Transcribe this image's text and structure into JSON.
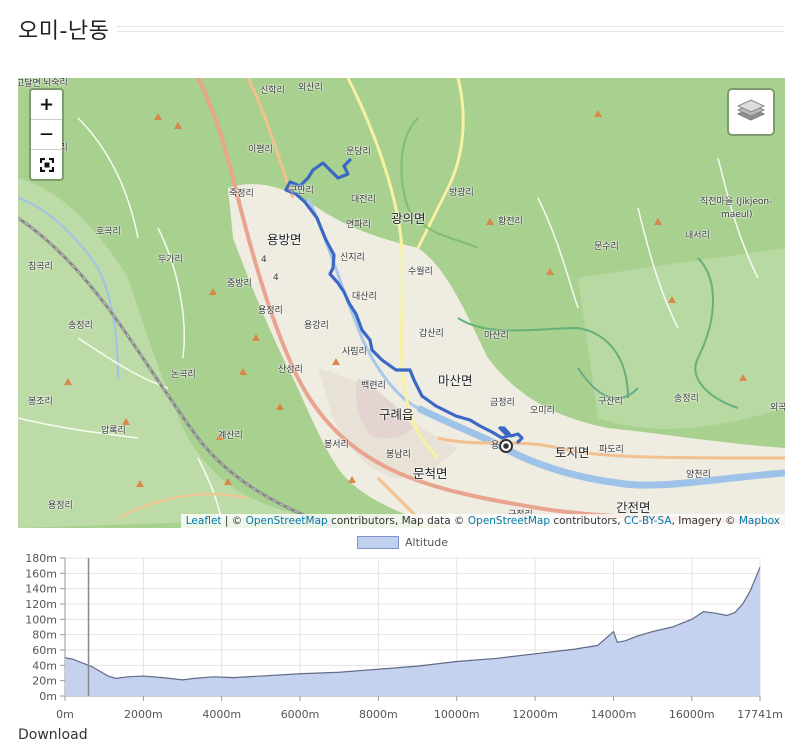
{
  "page": {
    "title": "오미-난동"
  },
  "map": {
    "zoom_in_label": "+",
    "zoom_out_label": "—",
    "fullscreen_label": "⛶",
    "attribution": {
      "leaflet": "Leaflet",
      "sep1": " | © ",
      "osm1": "OpenStreetMap",
      "mid1": " contributors, Map data © ",
      "osm2": "OpenStreetMap",
      "mid2": " contributors, ",
      "license": "CC-BY-SA",
      "mid3": ", Imagery © ",
      "mapbox": "Mapbox"
    },
    "places": [
      {
        "name": "고달면",
        "major": false
      },
      {
        "name": "뇌죽리",
        "major": false
      },
      {
        "name": "외산리",
        "major": false
      },
      {
        "name": "신학리",
        "major": false
      },
      {
        "name": "이평리",
        "major": false
      },
      {
        "name": "운당리",
        "major": false
      },
      {
        "name": "고달리",
        "major": false
      },
      {
        "name": "죽정리",
        "major": false
      },
      {
        "name": "구만리",
        "major": false
      },
      {
        "name": "대전리",
        "major": false
      },
      {
        "name": "방광리",
        "major": false
      },
      {
        "name": "용방면",
        "major": true
      },
      {
        "name": "연파리",
        "major": false
      },
      {
        "name": "광의면",
        "major": true
      },
      {
        "name": "황전리",
        "major": false
      },
      {
        "name": "직전마을 (Jikjeon-",
        "major": false
      },
      {
        "name": "maeul)",
        "major": false
      },
      {
        "name": "호곡리",
        "major": false
      },
      {
        "name": "두가리",
        "major": false
      },
      {
        "name": "신지리",
        "major": false
      },
      {
        "name": "수월리",
        "major": false
      },
      {
        "name": "내서리",
        "major": false
      },
      {
        "name": "문수리",
        "major": false
      },
      {
        "name": "침곡리",
        "major": false
      },
      {
        "name": "중방리",
        "major": false
      },
      {
        "name": "대산리",
        "major": false
      },
      {
        "name": "용정리",
        "major": false
      },
      {
        "name": "송정리",
        "major": false
      },
      {
        "name": "용강리",
        "major": false
      },
      {
        "name": "갑산리",
        "major": false
      },
      {
        "name": "마산리",
        "major": false
      },
      {
        "name": "사림리",
        "major": false
      },
      {
        "name": "논곡리",
        "major": false
      },
      {
        "name": "산성리",
        "major": false
      },
      {
        "name": "마산면",
        "major": true
      },
      {
        "name": "백련리",
        "major": false
      },
      {
        "name": "봉조리",
        "major": false
      },
      {
        "name": "구례읍",
        "major": true
      },
      {
        "name": "금정리",
        "major": false
      },
      {
        "name": "구산리",
        "major": false
      },
      {
        "name": "송정리",
        "major": false
      },
      {
        "name": "오미리",
        "major": false
      },
      {
        "name": "외곡",
        "major": false
      },
      {
        "name": "압록리",
        "major": false
      },
      {
        "name": "계산리",
        "major": false
      },
      {
        "name": "봉서리",
        "major": false
      },
      {
        "name": "토지면",
        "major": true
      },
      {
        "name": "파도리",
        "major": false
      },
      {
        "name": "봉남리",
        "major": false
      },
      {
        "name": "문척면",
        "major": true
      },
      {
        "name": "용정리",
        "major": false
      },
      {
        "name": "용",
        "major": false
      },
      {
        "name": "구정리",
        "major": false
      },
      {
        "name": "간전면",
        "major": true
      },
      {
        "name": "양천리",
        "major": false
      }
    ],
    "road_labels": [
      "4",
      "4"
    ]
  },
  "chart_data": {
    "type": "area",
    "legend": {
      "label": "Altitude",
      "position": "top-center"
    },
    "x_ticks": [
      "0m",
      "2000m",
      "4000m",
      "6000m",
      "8000m",
      "10000m",
      "12000m",
      "14000m",
      "16000m",
      "17741m"
    ],
    "y_ticks": [
      "0m",
      "20m",
      "40m",
      "60m",
      "80m",
      "100m",
      "120m",
      "140m",
      "160m",
      "180m"
    ],
    "xlim": [
      0,
      17741
    ],
    "ylim": [
      0,
      180
    ],
    "grid": true,
    "fill_color": "#c1d0ee",
    "line_color": "#606b86",
    "cursor_x": 600,
    "x": [
      0,
      200,
      500,
      700,
      900,
      1100,
      1300,
      1600,
      2000,
      2500,
      3000,
      3300,
      3800,
      4300,
      5000,
      6000,
      7000,
      8000,
      9000,
      10000,
      11000,
      12000,
      13000,
      13600,
      14000,
      14100,
      14300,
      14600,
      15000,
      15500,
      16000,
      16300,
      16600,
      16900,
      17100,
      17300,
      17500,
      17741
    ],
    "y": [
      50,
      48,
      42,
      38,
      32,
      26,
      23,
      25,
      26,
      24,
      21,
      23,
      25,
      24,
      26,
      29,
      31,
      35,
      39,
      45,
      49,
      55,
      61,
      66,
      84,
      70,
      72,
      78,
      84,
      90,
      100,
      110,
      108,
      105,
      109,
      120,
      138,
      168
    ]
  },
  "download": {
    "label": "Download"
  }
}
